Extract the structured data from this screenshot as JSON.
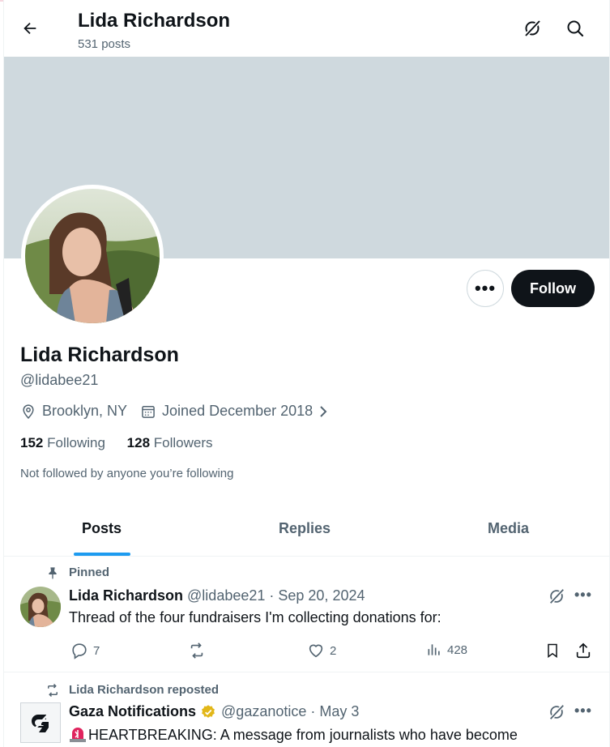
{
  "header": {
    "title": "Lida Richardson",
    "post_count": "531 posts",
    "icons": [
      "back-arrow-icon",
      "grok-icon",
      "search-icon"
    ]
  },
  "profile": {
    "name": "Lida Richardson",
    "handle": "@lidabee21",
    "location": "Brooklyn, NY",
    "joined": "Joined December 2018",
    "following_count": "152",
    "following_label": "Following",
    "followers_count": "128",
    "followers_label": "Followers",
    "not_followed_note": "Not followed by anyone you’re following",
    "more_label": "•••",
    "follow_label": "Follow"
  },
  "tabs": [
    {
      "label": "Posts",
      "active": true
    },
    {
      "label": "Replies",
      "active": false
    },
    {
      "label": "Media",
      "active": false
    }
  ],
  "posts": [
    {
      "context": "Pinned",
      "author_name": "Lida Richardson",
      "author_handle": "@lidabee21",
      "date": "· Sep 20, 2024",
      "text": "Thread of the four fundraisers I'm collecting donations for:",
      "replies": "7",
      "reposts": "",
      "likes": "2",
      "views": "428",
      "more_label": "•••"
    },
    {
      "context": "Lida Richardson reposted",
      "author_name": "Gaza Notifications",
      "author_handle": "@gazanotice",
      "date": "· May 3",
      "verified": true,
      "text": "HEARTBREAKING: A message from journalists who have become",
      "more_label": "•••"
    }
  ],
  "colors": {
    "accent": "#1d9bf0",
    "banner": "#cfd9de",
    "text_primary": "#0f1419",
    "text_secondary": "#536471",
    "follow_button": "#0f1419",
    "verified_badge": "#e2b719"
  }
}
